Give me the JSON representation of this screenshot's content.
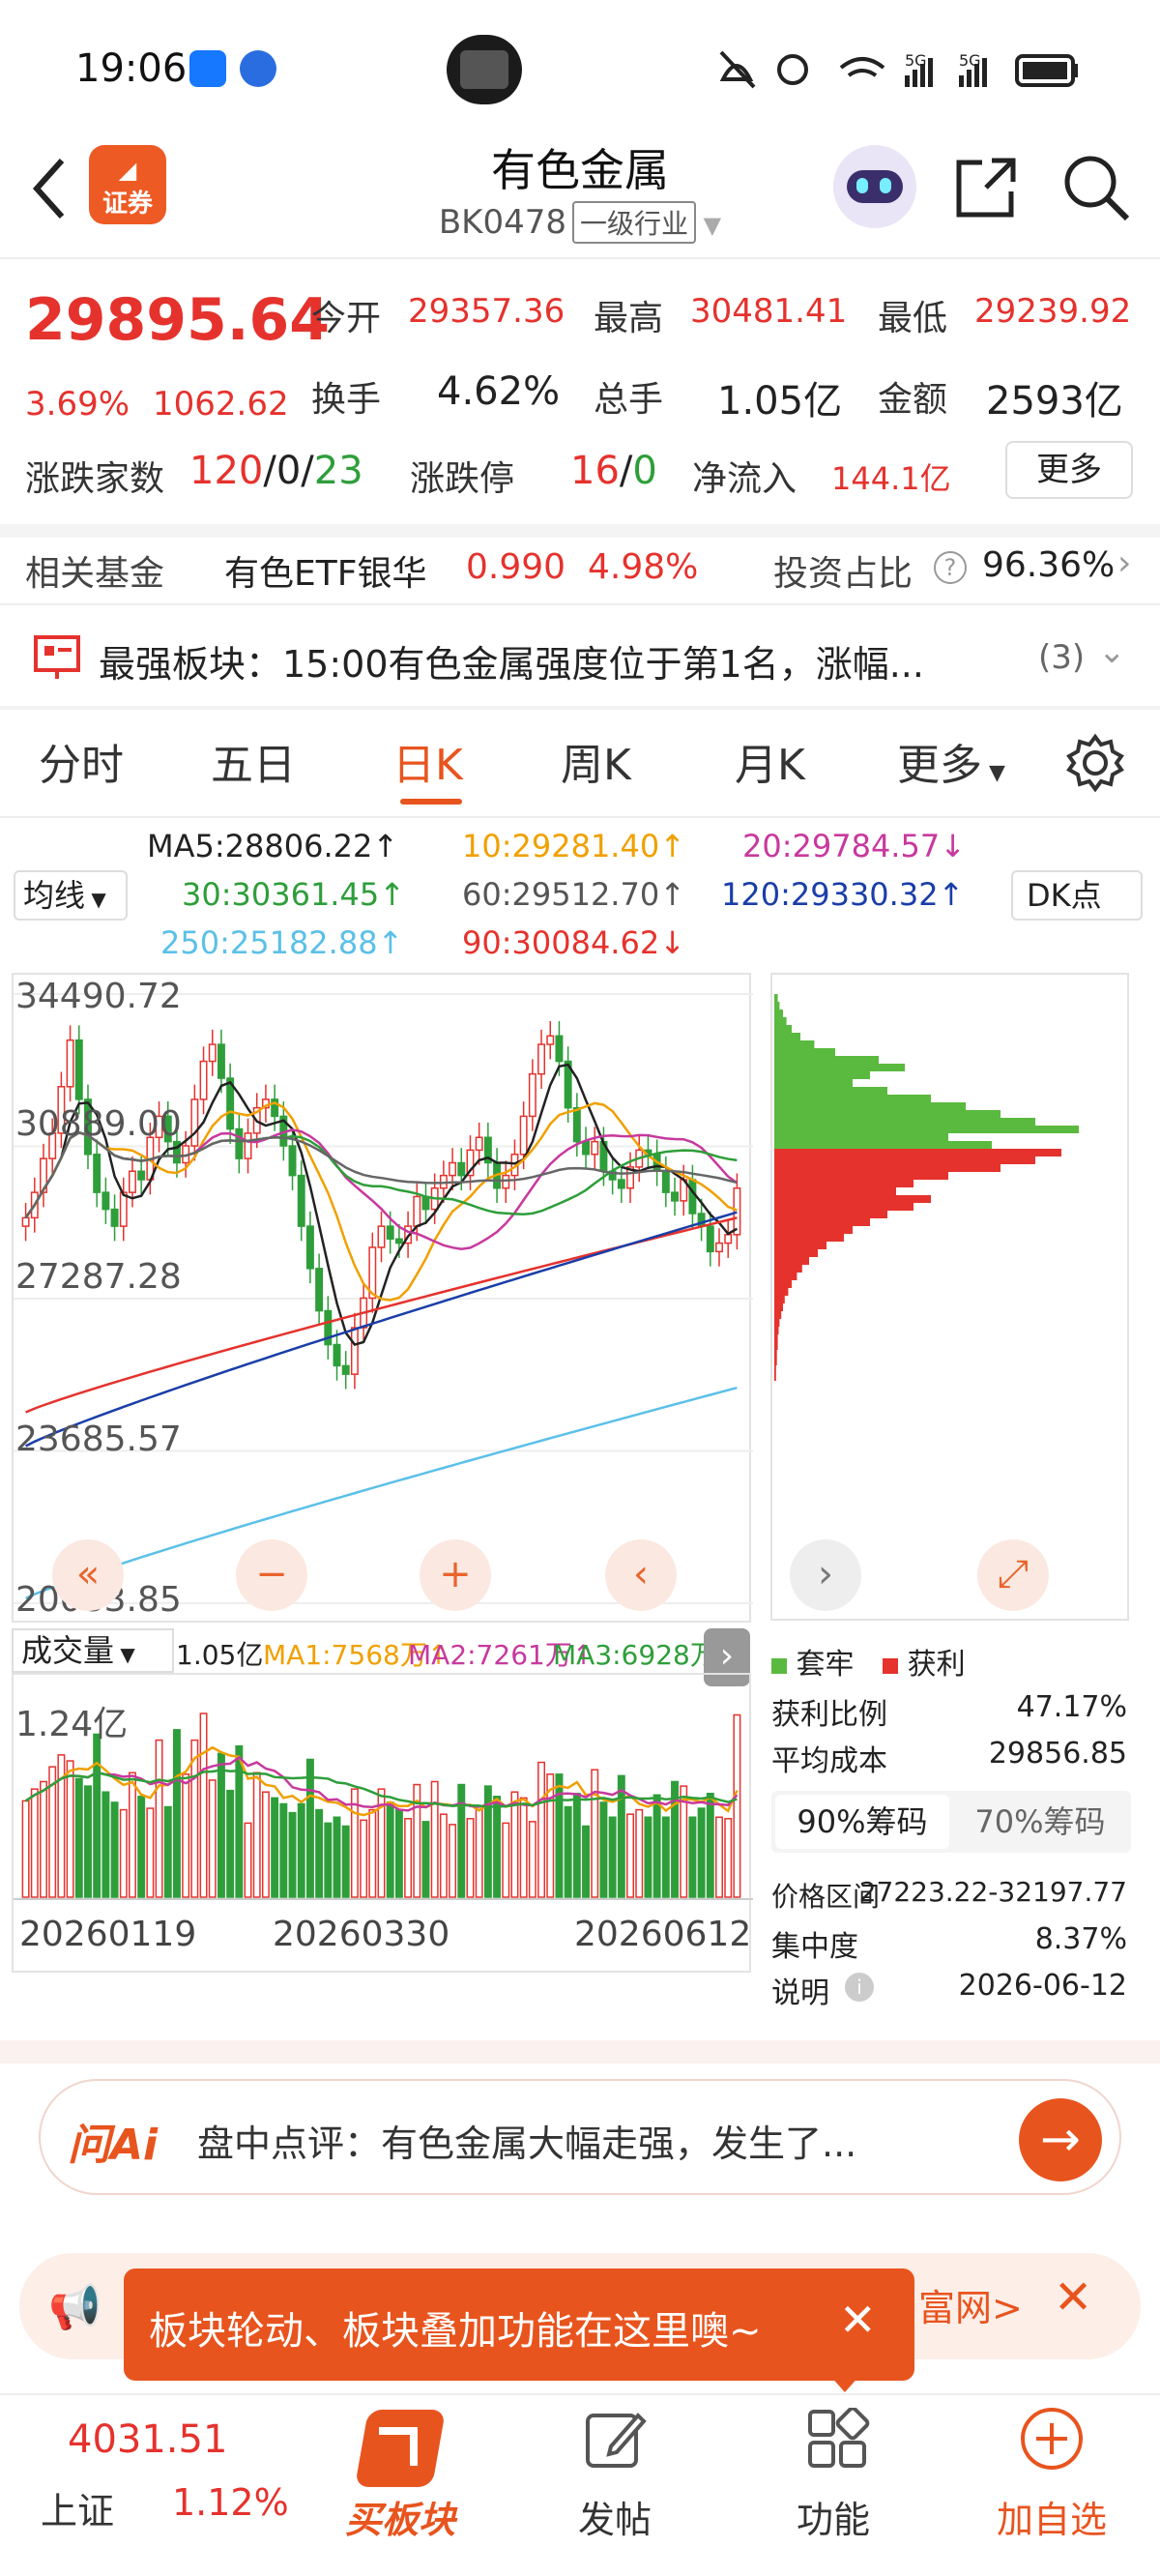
{
  "status_bar": {
    "time": "19:06"
  },
  "header": {
    "title": "有色金属",
    "code": "BK0478",
    "tag": "一级行业",
    "logo_text": "证券"
  },
  "quote": {
    "price": "29895.64",
    "change_pct": "3.69%",
    "change_pts": "1062.62",
    "open_label": "今开",
    "open": "29357.36",
    "high_label": "最高",
    "high": "30481.41",
    "low_label": "最低",
    "low": "29239.92",
    "turnover_label": "换手",
    "turnover": "4.62%",
    "volume_label": "总手",
    "volume": "1.05亿",
    "amount_label": "金额",
    "amount": "2593亿",
    "updown_label": "涨跌家数",
    "up_count": "120",
    "flat_count": "0",
    "down_count": "23",
    "limit_label": "涨跌停",
    "limit_up": "16",
    "limit_down": "0",
    "netflow_label": "净流入",
    "netflow": "144.1亿",
    "more": "更多",
    "slash": "/"
  },
  "fund": {
    "label": "相关基金",
    "name": "有色ETF银华",
    "price": "0.990",
    "pct": "4.98%",
    "ratio_label": "投资占比",
    "ratio": "96.36%"
  },
  "notice": {
    "text": "最强板块：15:00有色金属强度位于第1名，涨幅...",
    "count": "(3)"
  },
  "tabs": [
    "分时",
    "五日",
    "日K",
    "周K",
    "月K",
    "更多"
  ],
  "ma": {
    "selector": "均线",
    "dk": "DK点",
    "ma5": "MA5:28806.22↑",
    "ma10": "10:29281.40↑",
    "ma20": "20:29784.57↓",
    "ma30": "30:30361.45↑",
    "ma60": "60:29512.70↑",
    "ma120": "120:29330.32↑",
    "ma250": "250:25182.88↑",
    "ma90": "90:30084.62↓"
  },
  "chart_data": {
    "type": "candlestick",
    "y_ticks": [
      "34490.72",
      "30889.00",
      "27287.28",
      "23685.57",
      "20083.85"
    ],
    "ylim": [
      20083.85,
      34490.72
    ],
    "x_ticks": [
      "20260119",
      "20260330",
      "20260612"
    ],
    "closes": [
      29200,
      29800,
      30600,
      31200,
      32300,
      33400,
      32000,
      30700,
      29800,
      29400,
      29000,
      29800,
      30300,
      30100,
      31100,
      31600,
      31000,
      30500,
      30900,
      32000,
      32900,
      33300,
      32500,
      31300,
      30600,
      31200,
      31800,
      32000,
      31600,
      30900,
      30200,
      29000,
      28000,
      27000,
      26200,
      25700,
      25500,
      26600,
      27300,
      28500,
      29000,
      28700,
      28600,
      29000,
      29700,
      29400,
      29900,
      30200,
      30500,
      30200,
      30800,
      31100,
      30500,
      29900,
      30200,
      30700,
      31600,
      32600,
      33300,
      33500,
      32900,
      31800,
      31000,
      30700,
      31000,
      30300,
      30100,
      29900,
      30400,
      30800,
      30700,
      30300,
      29800,
      29600,
      30100,
      29300,
      29000,
      28400,
      28600,
      28800,
      29900
    ],
    "volume": {
      "label": "成交量",
      "total": "1.05亿",
      "ma1": "MA1:7568万↑",
      "ma2": "MA2:7261万↑",
      "ma3": "MA3:6928万↑",
      "ymax_label": "1.24亿",
      "values": [
        6.5,
        7.3,
        7.8,
        8.8,
        9.6,
        9.2,
        8.0,
        7.5,
        11.0,
        7.1,
        6.4,
        5.9,
        8.4,
        6.8,
        6.0,
        10.6,
        6.1,
        11.3,
        8.3,
        10.6,
        12.4,
        7.9,
        9.7,
        7.2,
        10.2,
        5.0,
        8.4,
        7.1,
        6.7,
        6.3,
        5.7,
        6.3,
        9.3,
        5.9,
        5.0,
        5.4,
        4.8,
        7.3,
        5.2,
        5.9,
        7.3,
        6.4,
        5.9,
        5.3,
        7.6,
        5.1,
        7.8,
        5.6,
        4.9,
        7.6,
        5.3,
        5.9,
        7.5,
        6.8,
        5.0,
        7.1,
        6.7,
        5.1,
        9.1,
        8.3,
        8.3,
        6.1,
        7.0,
        4.8,
        8.6,
        6.4,
        5.4,
        8.2,
        5.6,
        5.9,
        5.4,
        6.9,
        5.4,
        7.8,
        7.5,
        5.4,
        6.0,
        7.0,
        5.4,
        5.3,
        12.3
      ]
    }
  },
  "chip": {
    "legend_trapped": "套牢",
    "legend_profit": "获利",
    "profit_ratio_label": "获利比例",
    "profit_ratio": "47.17%",
    "avg_cost_label": "平均成本",
    "avg_cost": "29856.85",
    "tab90": "90%筹码",
    "tab70": "70%筹码",
    "range_label": "价格区间",
    "range": "27223.22-32197.77",
    "concentration_label": "集中度",
    "concentration": "8.37%",
    "note_label": "说明",
    "date": "2026-06-12"
  },
  "ai": {
    "logo": "问Ai",
    "text": "盘中点评：有色金属大幅走强，发生了..."
  },
  "tooltip": {
    "text": "板块轮动、板块叠加功能在这里噢~",
    "behind": "富网>"
  },
  "tabbar": {
    "index_value": "4031.51",
    "index_name": "上证",
    "index_pct": "1.12%",
    "buy": "买板块",
    "post": "发帖",
    "func": "功能",
    "add": "加自选"
  },
  "colors": {
    "accent": "#e8541e",
    "up": "#e5322d",
    "down": "#2e9e3a"
  }
}
